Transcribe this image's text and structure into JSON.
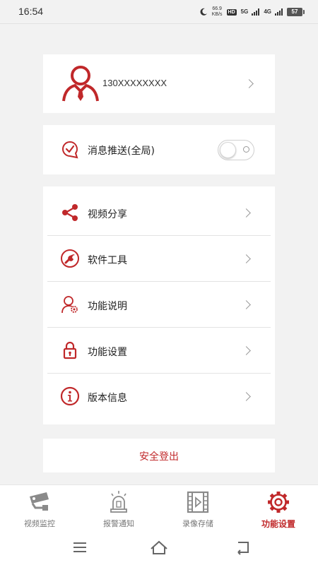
{
  "status_bar": {
    "time": "16:54",
    "net_speed_value": "66.9",
    "net_speed_unit": "KB/s",
    "hd_badge": "HD",
    "sim1_label": "5G",
    "sim2_label": "4G",
    "battery": "57"
  },
  "profile": {
    "phone": "130XXXXXXXX",
    "avatar_icon": "user-avatar-icon"
  },
  "push": {
    "label": "消息推送(全局)",
    "toggle_state": "off"
  },
  "menu": {
    "items": [
      {
        "label": "视频分享",
        "icon": "share-icon"
      },
      {
        "label": "软件工具",
        "icon": "wrench-icon"
      },
      {
        "label": "功能说明",
        "icon": "user-gear-icon"
      },
      {
        "label": "功能设置",
        "icon": "lock-icon"
      },
      {
        "label": "版本信息",
        "icon": "info-icon"
      }
    ]
  },
  "logout": {
    "label": "安全登出"
  },
  "tabs": [
    {
      "label": "视频监控",
      "icon": "camera-icon",
      "active": false
    },
    {
      "label": "报警通知",
      "icon": "alarm-icon",
      "active": false
    },
    {
      "label": "录像存储",
      "icon": "film-icon",
      "active": false
    },
    {
      "label": "功能设置",
      "icon": "gear-icon",
      "active": true
    }
  ],
  "colors": {
    "accent": "#c0282a",
    "inactive_tab": "#777777",
    "background": "#f2f2f2"
  }
}
